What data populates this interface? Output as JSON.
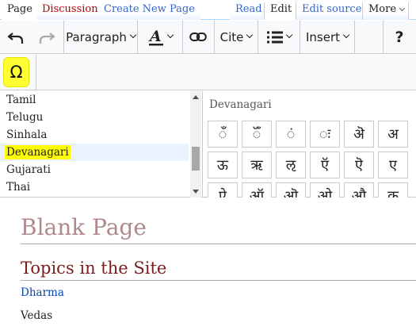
{
  "tabs": {
    "page": "Page",
    "discussion": "Discussion",
    "create_new_page": "Create New Page",
    "read": "Read",
    "edit": "Edit",
    "edit_source": "Edit source",
    "more": "More"
  },
  "toolbar": {
    "undo_icon": "undo-icon",
    "redo_icon": "redo-icon",
    "paragraph": "Paragraph",
    "text_style_icon": "text-style-icon",
    "link_icon": "link-icon",
    "cite": "Cite",
    "list_icon": "bulleted-list-icon",
    "insert": "Insert",
    "help": "?",
    "special_character": "Ω"
  },
  "special_chars": {
    "languages": [
      "Tamil",
      "Telugu",
      "Sinhala",
      "Devanagari",
      "Gujarati",
      "Thai"
    ],
    "selected_language": "Devanagari",
    "title": "Devanagari",
    "chars": [
      "ँ",
      "ॅँ",
      "ं",
      "ः",
      "ऄ",
      "अ",
      "ऊ",
      "ऋ",
      "ऌ",
      "ऍ",
      "ऎ",
      "ए",
      "ऐ",
      "ऑ",
      "ऒ",
      "ओ",
      "औ",
      "क"
    ]
  },
  "content": {
    "page_title": "Blank Page",
    "heading": "Topics in the Site",
    "link": "Dharma",
    "text": "Vedas"
  },
  "colors": {
    "highlight": "#ffff00",
    "link": "#0645ad",
    "heading": "#7b1c1c",
    "title": "#b08a8a"
  }
}
